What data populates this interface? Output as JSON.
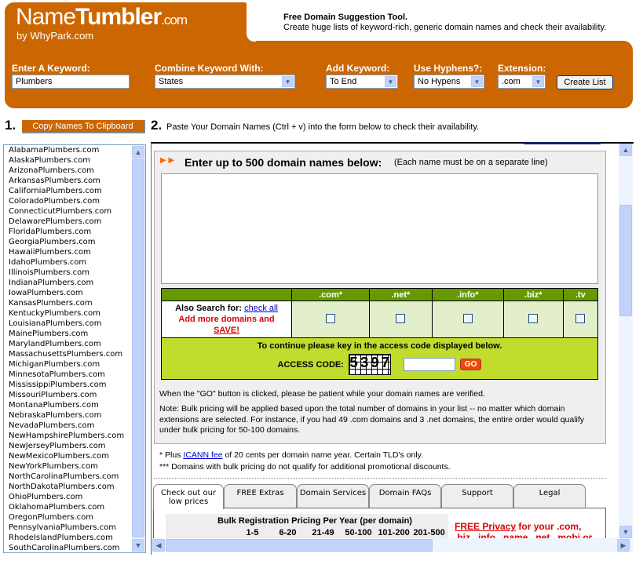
{
  "header": {
    "logo_name": "Name",
    "logo_bold": "Tumbler",
    "logo_tld": ".com",
    "byline": "by WhyPark.com",
    "tagline_title": "Free Domain Suggestion Tool.",
    "tagline_text": "Create huge lists of keyword-rich, generic domain names and check their availability."
  },
  "form": {
    "keyword_label": "Enter A Keyword:",
    "keyword_value": "Plumbers",
    "combine_label": "Combine Keyword With:",
    "combine_value": "States",
    "add_label": "Add Keyword:",
    "add_value": "To End",
    "hyphens_label": "Use Hyphens?:",
    "hyphens_value": "No Hypens",
    "ext_label": "Extension:",
    "ext_value": ".com",
    "create_button": "Create List"
  },
  "steps": {
    "step1_num": "1.",
    "copy_button": "Copy Names To Clipboard",
    "step2_num": "2.",
    "step2_text": "Paste Your Domain Names (Ctrl + v) into the form below to check their availability."
  },
  "names": [
    "AlabamaPlumbers.com",
    "AlaskaPlumbers.com",
    "ArizonaPlumbers.com",
    "ArkansasPlumbers.com",
    "CaliforniaPlumbers.com",
    "ColoradoPlumbers.com",
    "ConnecticutPlumbers.com",
    "DelawarePlumbers.com",
    "FloridaPlumbers.com",
    "GeorgiaPlumbers.com",
    "HawaiiPlumbers.com",
    "IdahoPlumbers.com",
    "IllinoisPlumbers.com",
    "IndianaPlumbers.com",
    "IowaPlumbers.com",
    "KansasPlumbers.com",
    "KentuckyPlumbers.com",
    "LouisianaPlumbers.com",
    "MainePlumbers.com",
    "MarylandPlumbers.com",
    "MassachusettsPlumbers.com",
    "MichiganPlumbers.com",
    "MinnesotaPlumbers.com",
    "MississippiPlumbers.com",
    "MissouriPlumbers.com",
    "MontanaPlumbers.com",
    "NebraskaPlumbers.com",
    "NevadaPlumbers.com",
    "NewHampshirePlumbers.com",
    "NewJerseyPlumbers.com",
    "NewMexicoPlumbers.com",
    "NewYorkPlumbers.com",
    "NorthCarolinaPlumbers.com",
    "NorthDakotaPlumbers.com",
    "OhioPlumbers.com",
    "OklahomaPlumbers.com",
    "OregonPlumbers.com",
    "PennsylvaniaPlumbers.com",
    "RhodeIslandPlumbers.com",
    "SouthCarolinaPlumbers.com"
  ],
  "checker": {
    "title": "Enter up to 500 domain names below:",
    "subtitle": "(Each name must be on a separate line)",
    "also_search": "Also Search for:",
    "check_all": "check all",
    "add_more": "Add more domains and",
    "save": "SAVE!",
    "extensions": [
      ".com*",
      ".net*",
      ".info*",
      ".biz*",
      ".tv"
    ],
    "access_prompt": "To continue please key in the access code displayed below.",
    "access_label": "ACCESS CODE:",
    "access_code": "5397",
    "go": "GO",
    "note1": "When the \"GO\" button is clicked, please be patient while your domain names are verified.",
    "note2": "Note: Bulk pricing will be applied based upon the total number of domains in your list -- no matter which domain extensions are selected.  For instance, if you had 49 .com domains and 3 .net domains, the entire order would qualify under bulk pricing for 50-100 domains."
  },
  "footnotes": {
    "plus": "* Plus",
    "icann": "ICANN fee",
    "plus_rest": "of 20 cents per domain name year. Certain TLD's only.",
    "bulk": "*** Domains with bulk pricing do not qualify for additional promotional discounts."
  },
  "tabs": [
    "Check out our low prices",
    "FREE Extras",
    "Domain Services",
    "Domain FAQs",
    "Support",
    "Legal"
  ],
  "pricing": {
    "title": "Bulk Registration Pricing Per Year (per domain)",
    "columns": [
      "1-5",
      "6-20",
      "21-49",
      "50-100",
      "101-200",
      "201-500"
    ],
    "promo_link": "FREE Privacy",
    "promo_text": "for your .com,",
    "promo_line2": ".biz, .info, .name, .net, .mobi or"
  },
  "colors": {
    "brand": "#cc6600",
    "green": "#669900",
    "lime": "#c2dc2e"
  }
}
